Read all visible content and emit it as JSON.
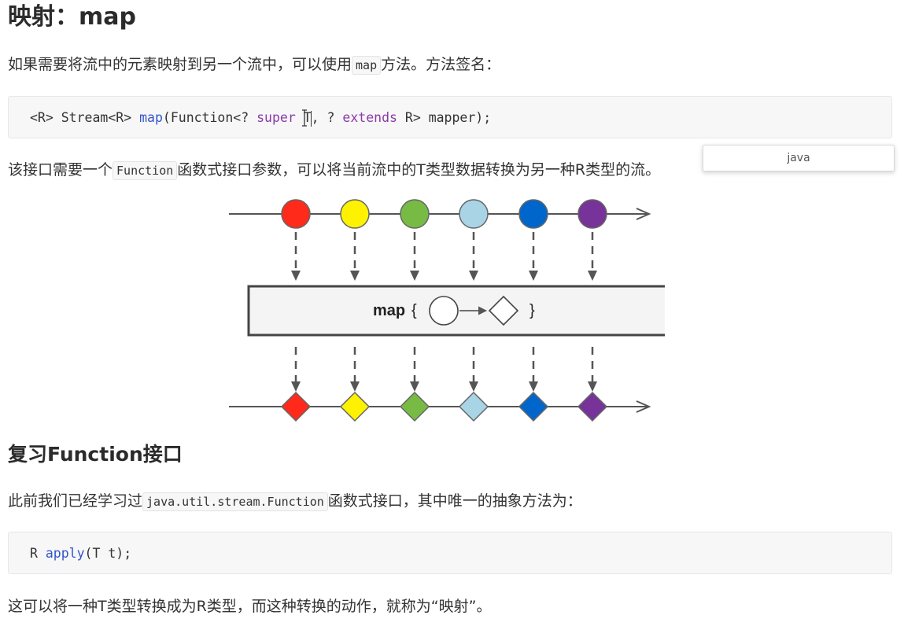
{
  "heading": "映射：map",
  "intro": {
    "before": "如果需要将流中的元素映射到另一个流中，可以使用",
    "code": "map",
    "after": "方法。方法签名："
  },
  "signature": {
    "part1": "<R> Stream<R> ",
    "method": "map",
    "part2": "(Function<? ",
    "kw_super": "super",
    "part3": " T",
    "part4": ", ? ",
    "kw_extends": "extends",
    "part5": " R> mapper);"
  },
  "lang_popup": "java",
  "desc": {
    "before": "该接口需要一个",
    "code": "Function",
    "after": "函数式接口参数，可以将当前流中的T类型数据转换为另一种R类型的流。"
  },
  "diagram": {
    "op_label": "map",
    "brace_open": "{",
    "brace_close": "}",
    "colors": [
      "#ff2a1a",
      "#fff200",
      "#77bb44",
      "#a8d4e6",
      "#0066cc",
      "#773399"
    ]
  },
  "review_heading": "复习Function接口",
  "review": {
    "before": "此前我们已经学习过",
    "code": "java.util.stream.Function",
    "after": "函数式接口，其中唯一的抽象方法为："
  },
  "apply_sig": {
    "part1": "R ",
    "method": "apply",
    "part2": "(T t);"
  },
  "conclusion": "这可以将一种T类型转换成为R类型，而这种转换的动作，就称为“映射”。"
}
